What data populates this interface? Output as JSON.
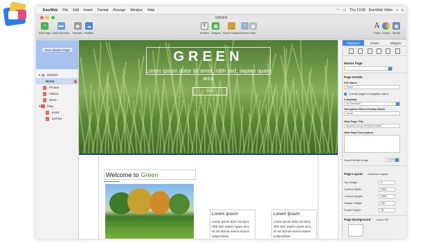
{
  "app": {
    "apple_glyph": "",
    "name": "EverWeb",
    "menu": [
      "File",
      "Edit",
      "Insert",
      "Format",
      "Arrange",
      "Window",
      "Help"
    ],
    "clock": "Thu 13:30",
    "user": "EverWeb Video",
    "window_title": "GREEN"
  },
  "toolbar": {
    "left": [
      {
        "label": "Add Page",
        "icon": "add-page-icon",
        "color": "#4caf50"
      },
      {
        "label": "Add Directory",
        "icon": "folder-icon",
        "color": "#5aa0e6"
      },
      {
        "label": "Preview",
        "icon": "eye-icon",
        "color": "#7a7a7a"
      },
      {
        "label": "Publish",
        "icon": "cloud-upload-icon",
        "color": "#4a86d8"
      }
    ],
    "center": [
      {
        "label": "TextBox",
        "icon": "textbox-icon",
        "glyph": "T",
        "color": "#555555"
      },
      {
        "label": "Shapes",
        "icon": "shapes-icon",
        "glyph": "▦",
        "color": "#4caf50"
      },
      {
        "label": "Scroll Position",
        "icon": "anchor-icon",
        "glyph": "⚓",
        "color": "#e0a020"
      },
      {
        "label": "Scenes",
        "icon": "scenes-icon",
        "glyph": "◔",
        "color": "#9ab0cc"
      },
      {
        "label": "Hide",
        "icon": "image-icon",
        "glyph": "▣",
        "color": "#b8b8b8"
      }
    ],
    "right": [
      {
        "label": "Fonts",
        "icon": "fonts-icon",
        "glyph": "A",
        "color": "#333333"
      },
      {
        "label": "Colors",
        "icon": "color-wheel-icon",
        "glyph": "●",
        "color": "#e25a9a"
      },
      {
        "label": "Media",
        "icon": "media-icon",
        "glyph": "▣",
        "color": "#6c8fb8"
      }
    ]
  },
  "sidebar": {
    "new_master_label": "New Master Page",
    "site_name": "GREEN",
    "items": [
      {
        "label": "Home",
        "kind": "page",
        "selected": true
      },
      {
        "label": "Photos",
        "kind": "page"
      },
      {
        "label": "Videos",
        "kind": "page"
      },
      {
        "label": "Store",
        "kind": "page"
      },
      {
        "label": "blog",
        "kind": "folder"
      },
      {
        "label": "posts",
        "kind": "page",
        "indent": true
      },
      {
        "label": "archive",
        "kind": "page",
        "indent": true
      }
    ]
  },
  "hero": {
    "title": "GREEN",
    "subtitle": "Lorem ipsum dolor sit amet, nibh sed, sapien quam arcu",
    "button": "GO"
  },
  "content": {
    "welcome_prefix": "Welcome to",
    "welcome_accent": "Green",
    "columns": [
      {
        "heading": "Lorem Ipsum",
        "body": "Lorem ipsum dolor sit amet, nibh sed, sapien quam arcu, sit est lacinia viverra mauris suspendisse."
      },
      {
        "heading": "Lorem Ipsum",
        "body": "Lorem ipsum dolor sit amet, nibh sed, sapien quam arcu, sit est lacinia viverra mauris suspendisse."
      }
    ]
  },
  "inspector": {
    "tabs": [
      "Inspector",
      "Assets",
      "Widgets"
    ],
    "master_page_label": "Master Page",
    "page_details_label": "Page Details",
    "file_name_label": "File Name",
    "file_name_value": "Home",
    "include_nav_label": "Include page in navigation menu",
    "include_nav_checked": true,
    "language_label": "Language",
    "language_value": "No Selection",
    "nav_display_label": "Navigation Menu Display Name",
    "nav_display_value": "Home",
    "web_title_label": "Web Page Title",
    "web_title_placeholder": "Appears at top of web browser",
    "web_desc_label": "Web Page Description",
    "social_label": "Social Media Image",
    "social_button": "Choose...",
    "page_layout_label": "Page Layout",
    "page_layout_value": "Centered Layout",
    "rows": [
      {
        "label": "Top Margin:",
        "value": "0"
      },
      {
        "label": "Content Width:",
        "value": "1000"
      },
      {
        "label": "Content Height:",
        "value": "1000"
      },
      {
        "label": "Header Height:",
        "value": "100"
      },
      {
        "label": "Footer Height:",
        "value": "75"
      }
    ],
    "page_bg_label": "Page Background",
    "page_bg_value": "Colour Fill"
  }
}
